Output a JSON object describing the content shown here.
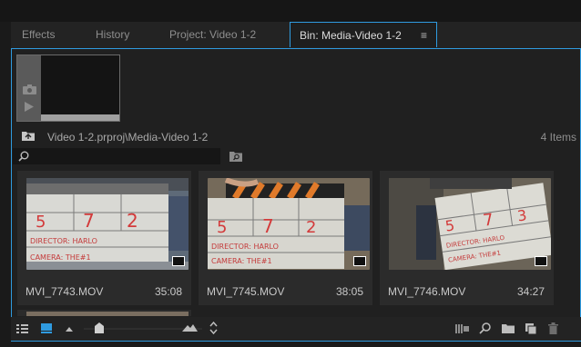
{
  "tabs": [
    {
      "label": "Effects"
    },
    {
      "label": "History"
    },
    {
      "label": "Project: Video 1-2"
    },
    {
      "label": "Bin: Media-Video 1-2",
      "active": true
    }
  ],
  "bin": {
    "path": "Video 1-2.prproj\\Media-Video 1-2",
    "item_count": "4 Items",
    "search_value": ""
  },
  "clips": [
    {
      "name": "MVI_7743.MOV",
      "duration": "35:08"
    },
    {
      "name": "MVI_7745.MOV",
      "duration": "38:05"
    },
    {
      "name": "MVI_7746.MOV",
      "duration": "34:27"
    }
  ],
  "zoom_level": 0.13,
  "colors": {
    "accent": "#2f9be0",
    "panel": "#202020",
    "card": "#2b2b2b"
  },
  "icons": [
    "camera-icon",
    "play-icon",
    "bin-up-icon",
    "search-icon",
    "find-icon",
    "list-view-icon",
    "icon-view-icon",
    "sort-icon",
    "automate-icon",
    "new-bin-icon",
    "new-item-icon",
    "clear-icon",
    "panel-menu-icon"
  ]
}
